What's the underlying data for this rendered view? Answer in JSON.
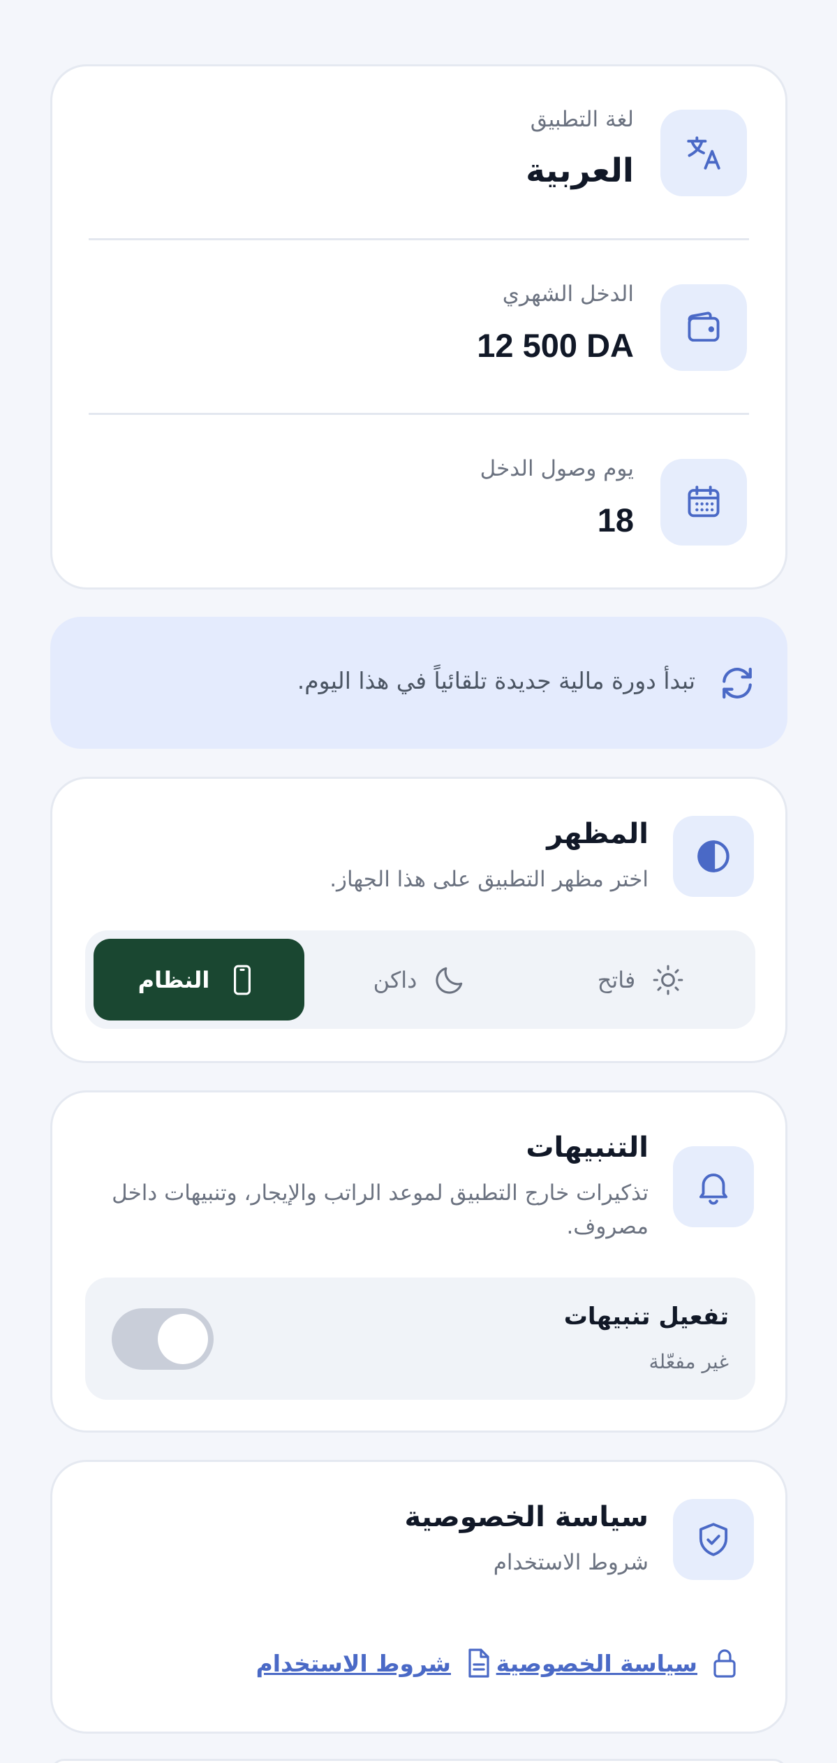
{
  "settings": {
    "language": {
      "label": "لغة التطبيق",
      "value": "العربية",
      "icon": "translate-icon"
    },
    "income": {
      "label": "الدخل الشهري",
      "value": "12 500 DA",
      "icon": "wallet-icon"
    },
    "income_day": {
      "label": "يوم وصول الدخل",
      "value": "18",
      "icon": "calendar-icon"
    }
  },
  "banner": {
    "text": "تبدأ دورة مالية جديدة تلقائياً في هذا اليوم.",
    "icon": "refresh-icon"
  },
  "appearance": {
    "title": "المظهر",
    "description": "اختر مظهر التطبيق على هذا الجهاز.",
    "icon": "contrast-icon",
    "options": [
      {
        "label": "فاتح",
        "icon": "sun-icon"
      },
      {
        "label": "داكن",
        "icon": "moon-icon"
      },
      {
        "label": "النظام",
        "icon": "phone-icon"
      }
    ],
    "selected": "النظام"
  },
  "notifications": {
    "title": "التنبيهات",
    "description": "تذكيرات خارج التطبيق لموعد الراتب والإيجار، وتنبيهات داخل مصروف.",
    "icon": "bell-icon",
    "toggle_label": "تفعيل تنبيهات",
    "toggle_status": "غير مفعّلة",
    "enabled": false
  },
  "privacy": {
    "title": "سياسة الخصوصية",
    "description": "شروط الاستخدام",
    "icon": "shield-check-icon",
    "links": [
      {
        "label": "سياسة الخصوصية",
        "icon": "lock-icon"
      },
      {
        "label": "شروط الاستخدام",
        "icon": "document-icon"
      }
    ]
  },
  "colors": {
    "background": "#f4f6fb",
    "icon_tile": "#e6edfc",
    "accent": "#4a69c6",
    "active_segment": "#1a4731",
    "banner": "#e4ebfd"
  }
}
